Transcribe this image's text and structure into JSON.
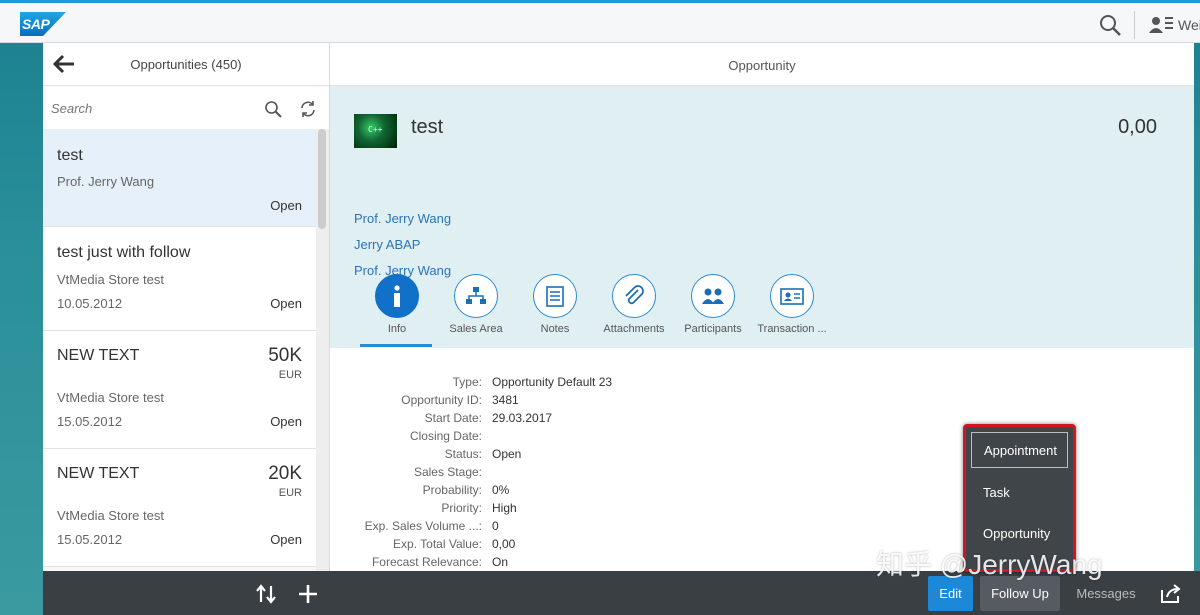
{
  "shell": {
    "user_name": "Wei"
  },
  "master": {
    "title": "Opportunities (450)",
    "search_placeholder": "Search",
    "items": [
      {
        "title": "test",
        "subtitle": "Prof. Jerry Wang",
        "date": "",
        "status": "Open",
        "number": "",
        "unit": ""
      },
      {
        "title": "test just with follow",
        "subtitle": "VtMedia Store test",
        "date": "10.05.2012",
        "status": "Open",
        "number": "",
        "unit": ""
      },
      {
        "title": "NEW TEXT",
        "subtitle": "VtMedia Store test",
        "date": "15.05.2012",
        "status": "Open",
        "number": "50K",
        "unit": "EUR"
      },
      {
        "title": "NEW TEXT",
        "subtitle": "VtMedia Store test",
        "date": "15.05.2012",
        "status": "Open",
        "number": "20K",
        "unit": "EUR"
      }
    ]
  },
  "detail": {
    "header_title": "Opportunity",
    "object": {
      "title": "test",
      "number": "0,00",
      "thumb_text": "C++",
      "links": [
        "Prof. Jerry Wang",
        "Jerry ABAP",
        "Prof. Jerry Wang"
      ]
    },
    "tabs": [
      {
        "label": "Info",
        "icon": "info-icon"
      },
      {
        "label": "Sales Area",
        "icon": "hierarchy-icon"
      },
      {
        "label": "Notes",
        "icon": "notes-icon"
      },
      {
        "label": "Attachments",
        "icon": "paperclip-icon"
      },
      {
        "label": "Participants",
        "icon": "group-icon"
      },
      {
        "label": "Transaction ...",
        "icon": "business-card-icon"
      }
    ],
    "fields": [
      {
        "label": "Type:",
        "value": "Opportunity Default 23"
      },
      {
        "label": "Opportunity ID:",
        "value": "3481"
      },
      {
        "label": "Start Date:",
        "value": "29.03.2017"
      },
      {
        "label": "Closing Date:",
        "value": ""
      },
      {
        "label": "Status:",
        "value": "Open"
      },
      {
        "label": "Sales Stage:",
        "value": ""
      },
      {
        "label": "Probability:",
        "value": "0%"
      },
      {
        "label": "Priority:",
        "value": "High"
      },
      {
        "label": "Exp. Sales Volume ...:",
        "value": "0"
      },
      {
        "label": "Exp. Total Value:",
        "value": "0,00"
      },
      {
        "label": "Forecast Relevance:",
        "value": "On"
      }
    ]
  },
  "footer": {
    "edit_label": "Edit",
    "follow_up_label": "Follow Up",
    "messages_label": "Messages"
  },
  "popover": {
    "items": [
      "Appointment",
      "Task",
      "Opportunity"
    ]
  },
  "watermark": "知乎 @JerryWang",
  "colors": {
    "accent": "#1b89d8",
    "header_bg": "#dfeff2",
    "highlight_border": "#d0161e"
  }
}
